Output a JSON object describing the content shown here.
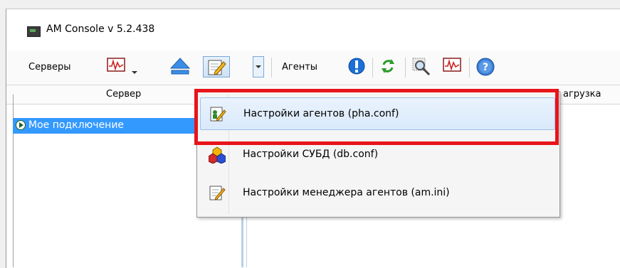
{
  "window": {
    "title": "AM Console v  5.2.438"
  },
  "toolbar": {
    "servers_label": "Серверы",
    "agents_label": "Агенты"
  },
  "grid": {
    "columns": {
      "server": "Сервер",
      "load": "агрузка"
    },
    "rows": [
      {
        "label": "Мое подключение",
        "selected": true
      }
    ]
  },
  "menu": {
    "items": [
      {
        "label": "Настройки агентов (pha.conf)",
        "highlighted": true,
        "icon": "agent-settings-icon"
      },
      {
        "label": "Настройки СУБД (db.conf)",
        "highlighted": false,
        "icon": "dbms-settings-icon"
      },
      {
        "label": "Настройки менеджера агентов (am.ini)",
        "highlighted": false,
        "icon": "manager-settings-icon"
      }
    ]
  },
  "colors": {
    "selection": "#3399ff",
    "highlight_frame": "#e8141b",
    "menu_highlight": "#d9e9fb"
  }
}
